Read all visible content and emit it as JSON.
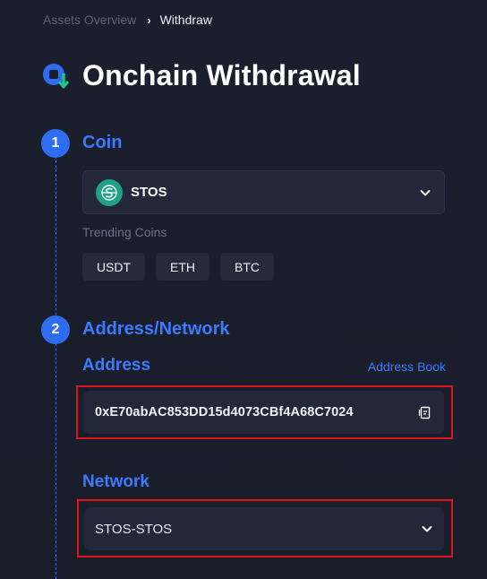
{
  "breadcrumb": {
    "parent": "Assets Overview",
    "current": "Withdraw"
  },
  "header": {
    "title": "Onchain Withdrawal",
    "icon": "withdraw-logo-icon"
  },
  "steps": [
    {
      "number": "1",
      "label": "Coin"
    },
    {
      "number": "2",
      "label": "Address/Network"
    }
  ],
  "coin": {
    "selected": "STOS",
    "icon": "stos-coin-icon",
    "trending_label": "Trending Coins",
    "trending": [
      "USDT",
      "ETH",
      "BTC"
    ]
  },
  "address": {
    "label": "Address",
    "book_link": "Address Book",
    "value": "0xE70abAC853DD15d4073CBf4A68C7024"
  },
  "network": {
    "label": "Network",
    "selected": "STOS-STOS"
  },
  "colors": {
    "background": "#1a1d2b",
    "accent": "#3b7bff",
    "step_circle": "#2f6df0",
    "field_bg": "#23273a",
    "highlight": "#e0141a",
    "coin_brand": "#1fa187"
  }
}
